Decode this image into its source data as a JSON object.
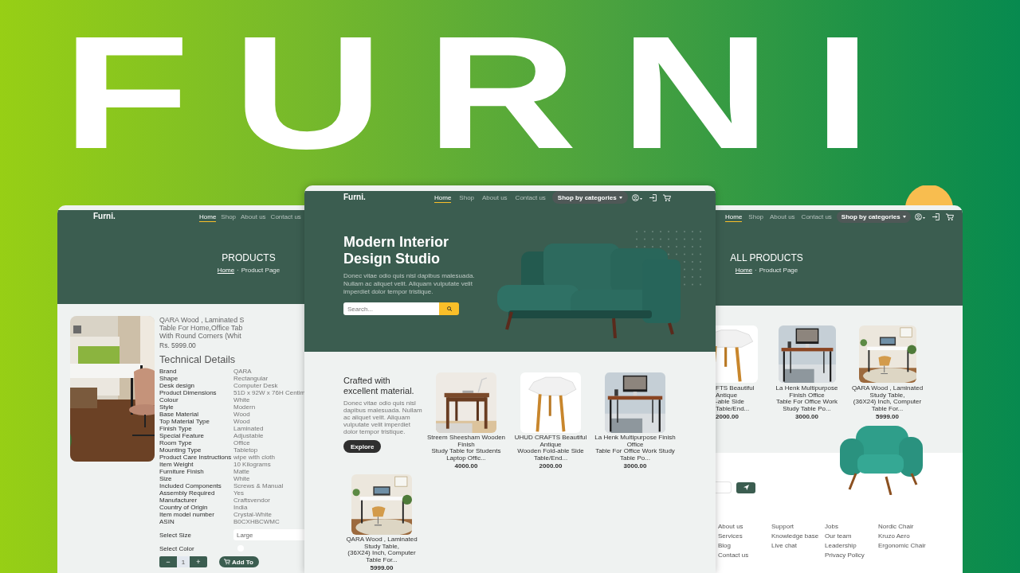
{
  "background_title": "FURNI",
  "product_window": {
    "logo": "Furni.",
    "nav": [
      {
        "label": "Home",
        "selected": true
      },
      {
        "label": "Shop",
        "selected": false
      },
      {
        "label": "About us",
        "selected": false
      },
      {
        "label": "Contact us",
        "selected": false
      }
    ],
    "page_title": "PRODUCTS",
    "breadcrumb": {
      "items": [
        {
          "label": "Home",
          "kind": "link"
        },
        {
          "label": "Product Page",
          "kind": "current"
        }
      ],
      "separator": "·"
    },
    "product": {
      "title_lines": [
        "QARA Wood , Laminated S",
        "Table For Home,Office Tab",
        "With Round Corners (Whit"
      ],
      "price": "Rs. 5999.00",
      "details_heading": "Technical Details",
      "details": [
        {
          "label": "Brand",
          "value": "QARA"
        },
        {
          "label": "Shape",
          "value": "Rectangular"
        },
        {
          "label": "Desk design",
          "value": "Computer Desk"
        },
        {
          "label": "Product Dimensions",
          "value": "51D x 92W x 76H Centim"
        },
        {
          "label": "Colour",
          "value": "White"
        },
        {
          "label": "Style",
          "value": "Modern"
        },
        {
          "label": "Base Material",
          "value": "Wood"
        },
        {
          "label": "Top Material Type",
          "value": "Wood"
        },
        {
          "label": "Finish Type",
          "value": "Laminated"
        },
        {
          "label": "Special Feature",
          "value": "Adjustable"
        },
        {
          "label": "Room Type",
          "value": "Office"
        },
        {
          "label": "Mounting Type",
          "value": "Tabletop"
        },
        {
          "label": "Product Care Instructions",
          "value": "wipe with cloth"
        },
        {
          "label": "Item Weight",
          "value": "10 Kilograms"
        },
        {
          "label": "Furniture Finish",
          "value": "Matte"
        },
        {
          "label": "Size",
          "value": "White"
        },
        {
          "label": "Included Components",
          "value": "Screws & Manual"
        },
        {
          "label": "Assembly Required",
          "value": "Yes"
        },
        {
          "label": "Manufacturer",
          "value": "Craftsvendor"
        },
        {
          "label": "Country of Origin",
          "value": "India"
        },
        {
          "label": "Item model number",
          "value": "Crystal-White"
        },
        {
          "label": "ASIN",
          "value": "B0CXHBCWMC"
        }
      ],
      "size_label": "Select Size",
      "size_value": "Large",
      "color_label": "Select Color",
      "colors": [
        {
          "color": "#ffffff"
        }
      ],
      "quantity": {
        "decrease": "−",
        "value": "1",
        "increase": "+"
      },
      "add_button": "Add To"
    }
  },
  "home_window": {
    "logo": "Furni.",
    "nav": [
      {
        "label": "Home",
        "selected": true
      },
      {
        "label": "Shop",
        "selected": false
      },
      {
        "label": "About us",
        "selected": false
      },
      {
        "label": "Contact us",
        "selected": false
      }
    ],
    "category_button": "Shop by categories",
    "hero": {
      "title": "Modern Interior Design Studio",
      "text": "Donec vitae odio quis nisl dapibus malesuada. Nullam ac aliquet velit. Aliquam vulputate velit imperdiet dolor tempor tristique.",
      "search_placeholder": "Search..."
    },
    "intro": {
      "title": "Crafted with excellent material.",
      "text": "Donec vitae odio quis nisl dapibus malesuada. Nullam ac aliquet velit. Aliquam vulputate velit imperdiet dolor tempor tristique.",
      "button": "Explore"
    },
    "products": [
      {
        "kind": "study-desk",
        "name_lines": [
          "Streem Sheesham Wooden Finish",
          "Study Table for Students Laptop Offic..."
        ],
        "price": "4000.00"
      },
      {
        "kind": "side-table",
        "name_lines": [
          "UHUD CRAFTS Beautiful Antique",
          "Wooden Fold-able Side Table/End..."
        ],
        "price": "2000.00"
      },
      {
        "kind": "computer-desk",
        "name_lines": [
          "La Henk Multipurpose Finish Office",
          "Table For Office Work Study Table Po..."
        ],
        "price": "3000.00"
      },
      {
        "kind": "desk-chair",
        "name_lines": [
          "QARA Wood , Laminated Study Table,",
          "(36X24) Inch, Computer Table For..."
        ],
        "price": "5999.00"
      }
    ]
  },
  "shop_window": {
    "nav": [
      {
        "label": "Home",
        "selected": true
      },
      {
        "label": "Shop",
        "selected": false
      },
      {
        "label": "About us",
        "selected": false
      },
      {
        "label": "Contact us",
        "selected": false
      }
    ],
    "category_button": "Shop by categories",
    "page_title": "ALL PRODUCTS",
    "breadcrumb": {
      "items": [
        {
          "label": "Home",
          "kind": "link"
        },
        {
          "label": "Product Page",
          "kind": "current"
        }
      ],
      "separator": "·"
    },
    "products": [
      {
        "kind": "side-table",
        "name_lines": [
          "FTS Beautiful Antique",
          "-able Side Table/End..."
        ],
        "price": "2000.00"
      },
      {
        "kind": "computer-desk",
        "name_lines": [
          "La Henk Multipurpose Finish Office",
          "Table For Office Work Study Table Po..."
        ],
        "price": "3000.00"
      },
      {
        "kind": "desk-chair",
        "name_lines": [
          "QARA Wood , Laminated Study Table,",
          "(36X24) Inch, Computer Table For..."
        ],
        "price": "5999.00"
      }
    ],
    "footer_columns": [
      {
        "links": [
          "About us",
          "Services",
          "Blog",
          "Contact us"
        ]
      },
      {
        "links": [
          "Support",
          "Knowledge base",
          "Live chat"
        ]
      },
      {
        "links": [
          "Jobs",
          "Our team",
          "Leadership",
          "Privacy Policy"
        ]
      },
      {
        "links": [
          "Nordic Chair",
          "Kruzo Aero",
          "Ergonomic Chair"
        ]
      }
    ]
  }
}
